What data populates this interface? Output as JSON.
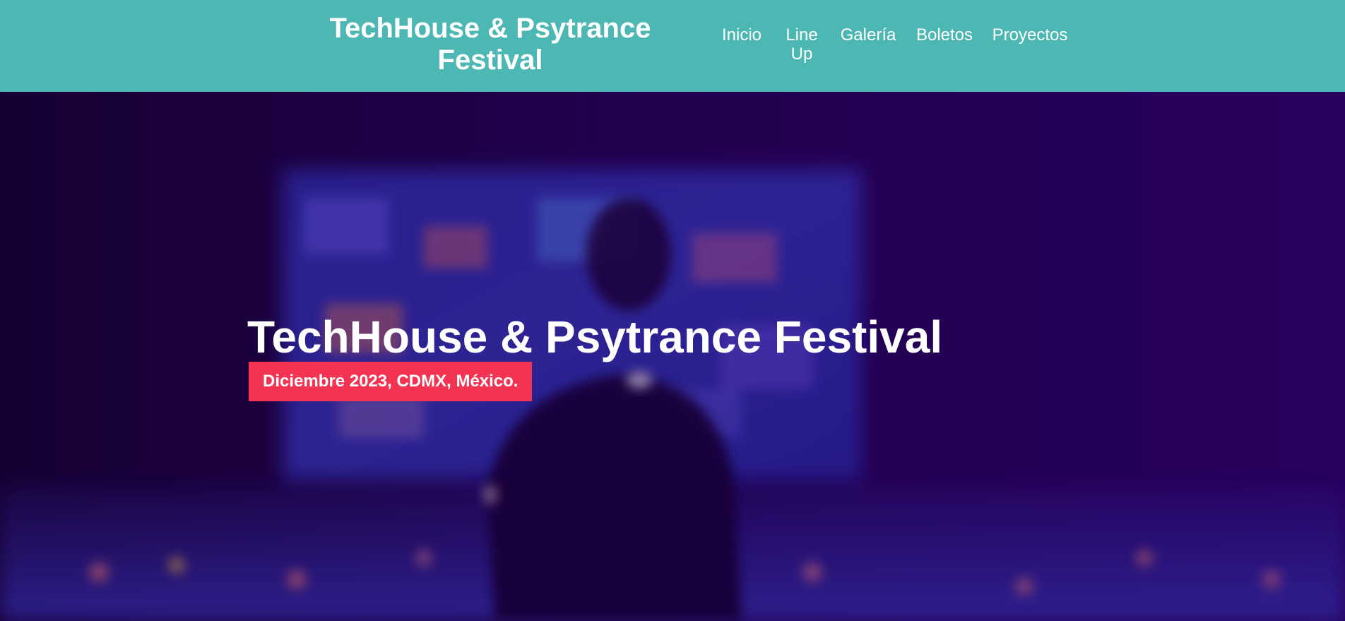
{
  "header": {
    "site_title": "TechHouse & Psytrance Festival",
    "nav": [
      {
        "label": "Inicio"
      },
      {
        "label": "Line Up"
      },
      {
        "label": "Galería"
      },
      {
        "label": "Boletos"
      },
      {
        "label": "Proyectos"
      }
    ]
  },
  "hero": {
    "title": "TechHouse & Psytrance Festival",
    "subtitle": "Diciembre 2023, CDMX, México."
  },
  "colors": {
    "header_background": "#4db8b3",
    "badge_background": "#f23352",
    "hero_tint": "#2a0060",
    "text": "#ffffff"
  }
}
